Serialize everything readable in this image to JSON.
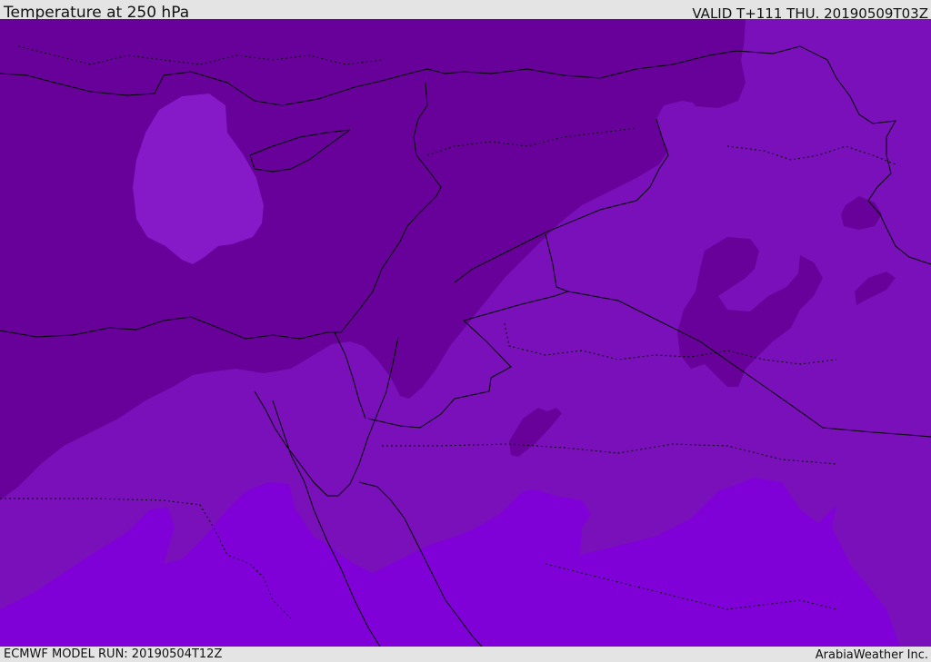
{
  "header": {
    "title": "Temperature at 250 hPa",
    "valid_time": "VALID T+111 THU. 20190509T03Z"
  },
  "footer": {
    "model_run": "ECMWF MODEL RUN: 20190504T12Z",
    "credit": "ArabiaWeather Inc."
  },
  "map": {
    "shading_colors": {
      "coldest": "#68009a",
      "cold": "#7410b0",
      "mild": "#7a10ba",
      "warm": "#8000d8",
      "pocket": "#8619c8"
    },
    "border_color": "#000000"
  }
}
